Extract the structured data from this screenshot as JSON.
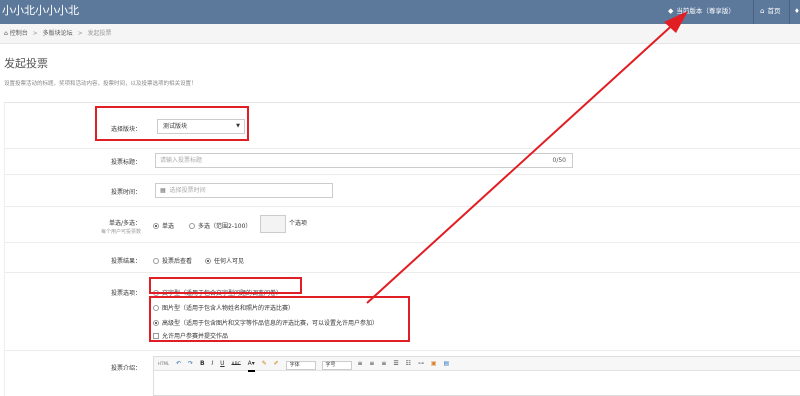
{
  "header": {
    "brand": "小小北小小小北",
    "version_label": "当前版本（尊享版）",
    "home_label": "首页",
    "colors": {
      "bar": "#5c799b",
      "highlight": "#e01e24"
    }
  },
  "breadcrumb": {
    "items": [
      "控制台",
      "多版块论坛",
      "发起投票"
    ]
  },
  "page": {
    "title": "发起投票",
    "description": "设置投票活动的标题，奖项和活动内容，投票时间，以及投票选项的相关设置！"
  },
  "form": {
    "board": {
      "label": "选择版块：",
      "value": "测试版块"
    },
    "vote_title": {
      "label": "投票标题：",
      "placeholder": "请输入投票标题",
      "counter": "0/50"
    },
    "vote_time": {
      "label": "投票时间：",
      "placeholder": "选择投票时间"
    },
    "choice": {
      "label": "单选/多选：",
      "sublabel": "每个用户可投票数",
      "single": "单选",
      "multi": "多选（范围2-100）",
      "unit": "个选项",
      "selected": "single"
    },
    "result": {
      "label": "投票结果：",
      "after_vote": "投票后查看",
      "anyone": "任何人可见",
      "selected": "anyone"
    },
    "options": {
      "label": "投票选项：",
      "text_type": "文字型（适用于包含文字型问题的调查问卷）",
      "image_type": "图片型（适用于包含人物姓名和照片的评选比赛）",
      "advanced_type": "高级型（适用于包含图片和文字等作品信息的评选比赛，可以设置允许用户参加）",
      "allow_submit": "允许用户参赛并提交作品",
      "selected": "advanced"
    },
    "intro": {
      "label": "投票介绍：",
      "toolbar": {
        "html": "HTML",
        "bold": "B",
        "italic": "I",
        "underline": "U",
        "strike": "ABC",
        "font": "字体",
        "size": "字号"
      }
    }
  }
}
